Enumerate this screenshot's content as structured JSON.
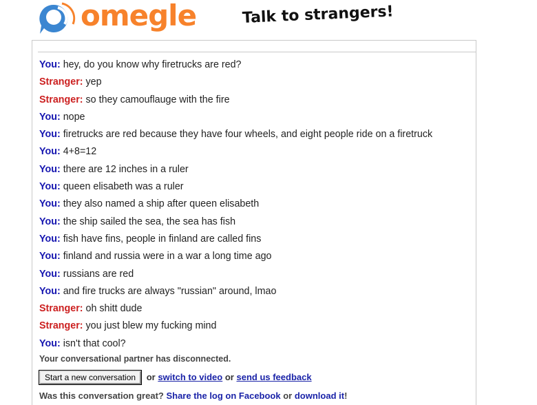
{
  "header": {
    "logo_text": "omegle",
    "tagline": "Talk to strangers!",
    "colors": {
      "logo_orange": "#f7822b",
      "logo_blue": "#3b86d1"
    }
  },
  "messages": [
    {
      "speaker": "You",
      "text": "hey, do you know why firetrucks are red?"
    },
    {
      "speaker": "Stranger",
      "text": "yep"
    },
    {
      "speaker": "Stranger",
      "text": "so they camouflauge with the fire"
    },
    {
      "speaker": "You",
      "text": "nope"
    },
    {
      "speaker": "You",
      "text": "firetrucks are red because they have four wheels, and eight people ride on a firetruck"
    },
    {
      "speaker": "You",
      "text": "4+8=12"
    },
    {
      "speaker": "You",
      "text": "there are 12 inches in a ruler"
    },
    {
      "speaker": "You",
      "text": "queen elisabeth was a ruler"
    },
    {
      "speaker": "You",
      "text": "they also named a ship after queen elisabeth"
    },
    {
      "speaker": "You",
      "text": "the ship sailed the sea, the sea has fish"
    },
    {
      "speaker": "You",
      "text": "fish have fins, people in finland are called fins"
    },
    {
      "speaker": "You",
      "text": "finland and russia were in a war a long time ago"
    },
    {
      "speaker": "You",
      "text": "russians are red"
    },
    {
      "speaker": "You",
      "text": "and fire trucks are always \"russian\" around, lmao"
    },
    {
      "speaker": "Stranger",
      "text": "oh shitt dude"
    },
    {
      "speaker": "Stranger",
      "text": "you just blew my fucking mind"
    },
    {
      "speaker": "You",
      "text": "isn't that cool?"
    }
  ],
  "status": "Your conversational partner has disconnected.",
  "actions": {
    "new_conversation_label": "Start a new conversation",
    "or_1": "or",
    "switch_to_video_label": "switch to video",
    "or_2": "or",
    "send_feedback_label": "send us feedback"
  },
  "footer": {
    "question": "Was this conversation great?",
    "share_label": "Share the log on Facebook",
    "or": "or",
    "download_label": "download it",
    "end": "!"
  },
  "colors": {
    "you": "#1515b0",
    "stranger": "#cc2020",
    "link": "#1a23a8"
  }
}
